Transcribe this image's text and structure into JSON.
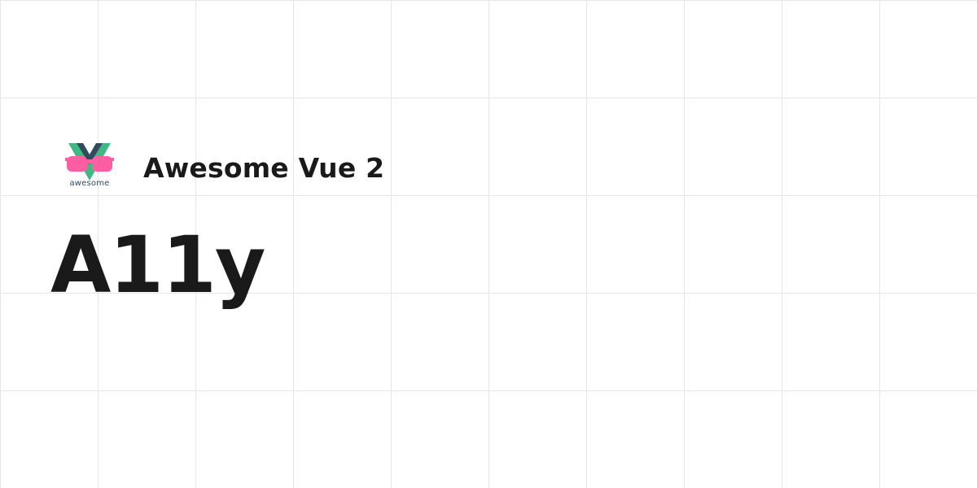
{
  "brand": {
    "logo_icon": "awesome-vue-logo-icon",
    "logo_caption": "awesome",
    "site_name": "Awesome Vue 2"
  },
  "page": {
    "title": "A11y"
  },
  "colors": {
    "background": "#ffffff",
    "grid_line": "#e6e6e6",
    "text": "#1a1a1a",
    "vue_green": "#41b883",
    "vue_dark": "#35495e",
    "glasses_pink": "#ff5fa2"
  }
}
